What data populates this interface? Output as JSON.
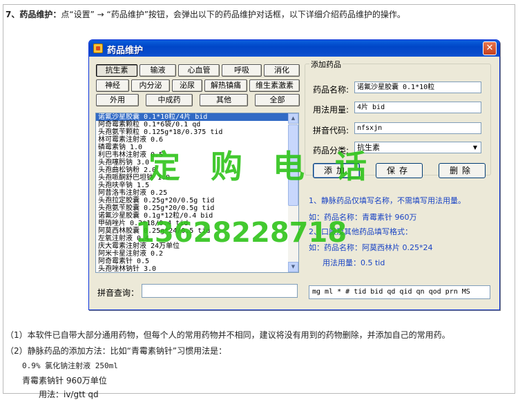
{
  "intro": {
    "number": "7、",
    "title": "药品维护：",
    "text": "点“设置” → “药品维护”按钮，会弹出以下的药品维护对话框，以下详细介绍药品维护的操作。"
  },
  "window": {
    "title": "药品维护",
    "close": "✕"
  },
  "categories": {
    "row1": [
      "抗生素",
      "输液",
      "心血管",
      "呼吸",
      "消化"
    ],
    "row2": [
      "神经",
      "内分泌",
      "泌尿",
      "解热镇痛",
      "维生素激素"
    ],
    "row3": [
      "外用",
      "中成药",
      "其他",
      "全部"
    ]
  },
  "drug_list": [
    "诺氟沙星胶囊  0.1*10粒/4片  bid",
    "阿奇霉素颗粒  0.1*6袋/0.1  qd",
    "头孢氨苄颗粒  0.125g*18/0.375 tid",
    "林可霉素注射液  0.6",
    "磷霉素钠  1.0",
    "利巴韦林注射液  0.5",
    "头孢噻肟钠  3.0",
    "头孢曲松钠粉  2.0",
    "头孢哌酮舒巴坦钠  1.0",
    "头孢呋辛钠  1.5",
    "阿昔洛韦注射液  0.25",
    "头孢拉定胶囊  0.25g*20/0.5g tid",
    "头孢氨苄胶囊  0.25g*20/0.5g tid",
    "诺氟沙星胶囊  0.1g*12粒/0.4  bid",
    "甲硝唑片  0.2*18/0.4 tid",
    "阿莫西林胶囊  0.25g*24/0.5 tid",
    "左氧注射液  0.4",
    "庆大霉素注射液  24万单位",
    "阿米卡星注射液  0.2",
    "阿奇霉素针  0.5",
    "头孢唑林钠针  3.0"
  ],
  "search": {
    "label": "拼音查询：",
    "value": ""
  },
  "add_drug": {
    "group_label": "添加药品",
    "name_label": "药品名称:",
    "name_value": "诺氟沙星胶囊  0.1*10粒",
    "dosage_label": "用法用量:",
    "dosage_value": "4片  bid",
    "pinyin_label": "拼音代码:",
    "pinyin_value": "nfsxjn",
    "category_label": "药品分类:",
    "category_value": "抗生素",
    "btn_add": "添加",
    "btn_save": "保存",
    "btn_delete": "删除"
  },
  "notes": {
    "n1": "1、静脉药品仅填写名称，不需填写用法用量。",
    "n2": "如：药品名称：青霉素针 960万",
    "n3": "2、口服及其他药品填写格式：",
    "n4": "如：药品名称：阿莫西林片 0.25*24",
    "n5": "用法用量：0.5 tid"
  },
  "units": "mg  ml  *   #  tid  bid  qd  qid  qn  qod  prn  MS",
  "watermark": {
    "text": "定 购 电 话",
    "phone": "13628228718"
  },
  "paragraphs": {
    "p1": "（1）本软件已自带大部分通用药物，但每个人的常用药物并不相同，建议将没有用到的药物删除，并添加自己的常用药。",
    "p2": "（2）静脉药品的添加方法：比如“青霉素钠针”习惯用法是：",
    "p3": "0.9% 氯化钠注射液 250ml",
    "p4": "青霉素钠针 960万单位",
    "p5": "用法：iv/gtt qd"
  },
  "colors": {
    "titlebar": "#0046c8",
    "selection": "#316ac5",
    "note_text": "#1a44c4",
    "watermark": "#2fc41a"
  }
}
